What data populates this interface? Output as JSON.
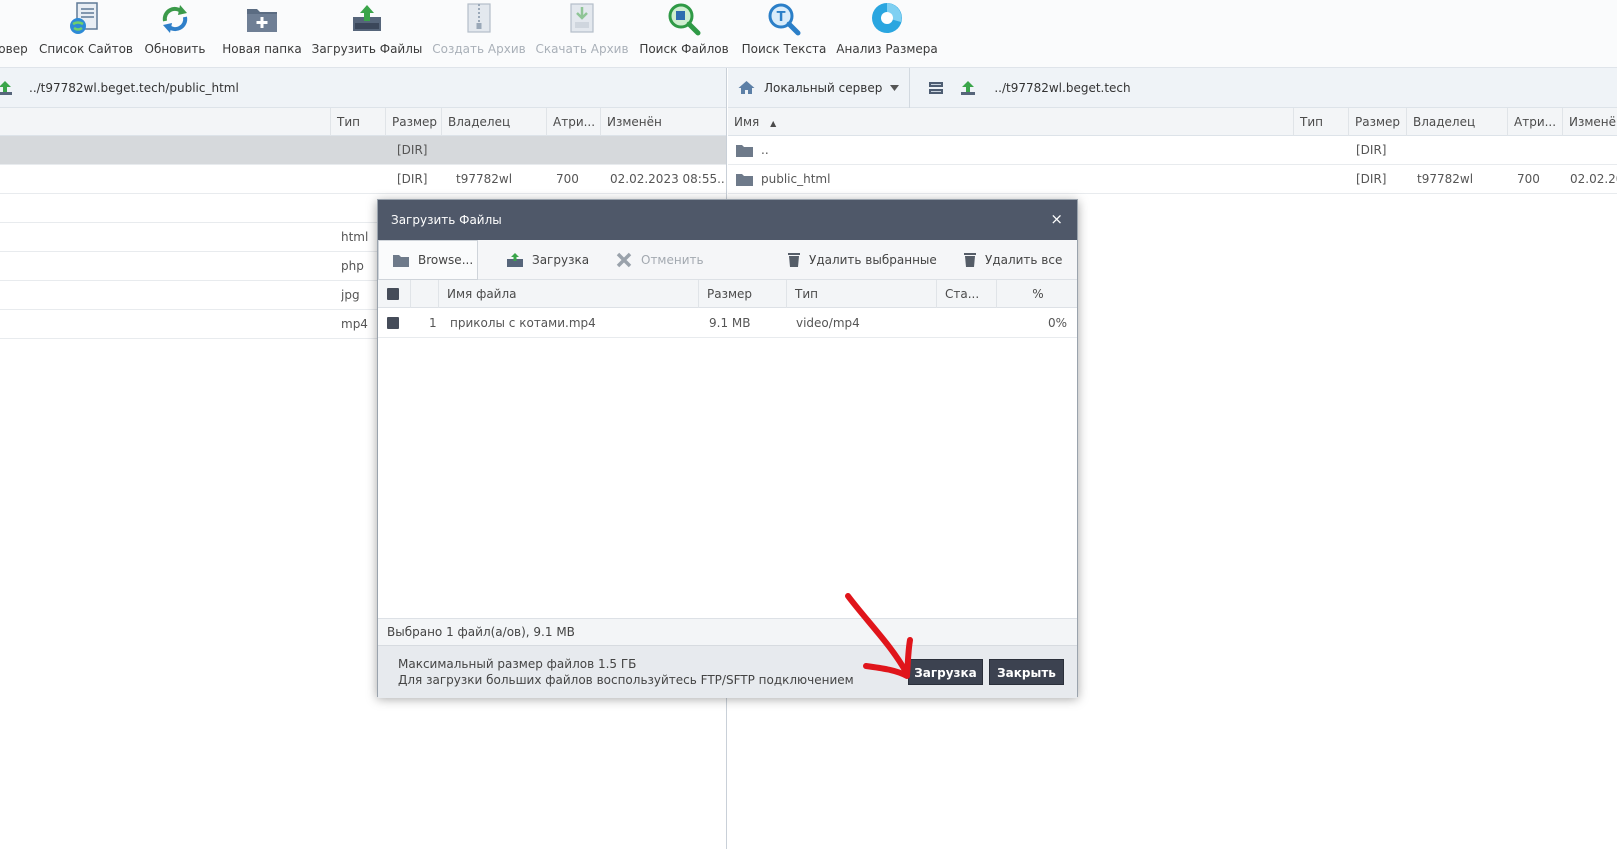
{
  "toolbar": {
    "items": [
      {
        "label": "овер",
        "icon": "server-icon",
        "disabled": false
      },
      {
        "label": "Список Сайтов",
        "icon": "site-list-icon",
        "disabled": false
      },
      {
        "label": "Обновить",
        "icon": "refresh-icon",
        "disabled": false
      },
      {
        "label": "Новая папка",
        "icon": "new-folder-icon",
        "disabled": false
      },
      {
        "label": "Загрузить Файлы",
        "icon": "upload-files-icon",
        "disabled": false
      },
      {
        "label": "Создать Архив",
        "icon": "create-archive-icon",
        "disabled": true
      },
      {
        "label": "Скачать Архив",
        "icon": "download-archive-icon",
        "disabled": true
      },
      {
        "label": "Поиск Файлов",
        "icon": "file-search-icon",
        "disabled": false
      },
      {
        "label": "Поиск Текста",
        "icon": "text-search-icon",
        "disabled": false
      },
      {
        "label": "Анализ Размера",
        "icon": "size-analysis-icon",
        "disabled": false
      }
    ]
  },
  "left_panel": {
    "path": "../t97782wl.beget.tech/public_html",
    "columns": {
      "type": "Тип",
      "size": "Размер",
      "owner": "Владелец",
      "attrs": "Атри...",
      "modified": "Изменён"
    },
    "rows": [
      {
        "type": "",
        "size": "[DIR]",
        "owner": "",
        "attrs": "",
        "modified": ""
      },
      {
        "type": "",
        "size": "[DIR]",
        "owner": "t97782wl",
        "attrs": "700",
        "modified": "02.02.2023 08:55..."
      },
      {
        "type": "",
        "size": "",
        "owner": "",
        "attrs": "",
        "modified": ""
      },
      {
        "type": "html",
        "size": "",
        "owner": "",
        "attrs": "",
        "modified": ""
      },
      {
        "type": "php",
        "size": "",
        "owner": "",
        "attrs": "",
        "modified": ""
      },
      {
        "type": "jpg",
        "size": "",
        "owner": "",
        "attrs": "",
        "modified": ""
      },
      {
        "type": "mp4",
        "size": "",
        "owner": "",
        "attrs": "",
        "modified": ""
      }
    ]
  },
  "right_panel": {
    "server_label": "Локальный сервер",
    "path": "../t97782wl.beget.tech",
    "columns": {
      "name": "Имя",
      "type": "Тип",
      "size": "Размер",
      "owner": "Владелец",
      "attrs": "Атри...",
      "modified": "Изменён"
    },
    "rows": [
      {
        "name": "..",
        "type": "",
        "size": "[DIR]",
        "owner": "",
        "attrs": "",
        "modified": ""
      },
      {
        "name": "public_html",
        "type": "",
        "size": "[DIR]",
        "owner": "t97782wl",
        "attrs": "700",
        "modified": "02.02.20"
      }
    ]
  },
  "dialog": {
    "title": "Загрузить Файлы",
    "close_glyph": "×",
    "toolbar": {
      "browse": "Browse...",
      "upload": "Загрузка",
      "cancel": "Отменить",
      "delete_selected": "Удалить выбранные",
      "delete_all": "Удалить все"
    },
    "columns": {
      "name": "Имя файла",
      "size": "Размер",
      "type": "Тип",
      "status": "Ста...",
      "percent": "%"
    },
    "files": [
      {
        "num": "1",
        "name": "приколы с котами.mp4",
        "size": "9.1 MB",
        "type": "video/mp4",
        "status": "",
        "percent": "0%"
      }
    ],
    "status": "Выбрано 1 файл(а/ов), 9.1 MB",
    "footer_line1": "Максимальный размер файлов 1.5 ГБ",
    "footer_line2": "Для загрузки больших файлов воспользуйтесь FTP/SFTP подключением",
    "upload_button": "Загрузка",
    "close_button": "Закрыть"
  },
  "colors": {
    "dialog_title_bg": "#4f5869",
    "button_bg": "#3c4250",
    "annotation_arrow": "#e0151b"
  }
}
